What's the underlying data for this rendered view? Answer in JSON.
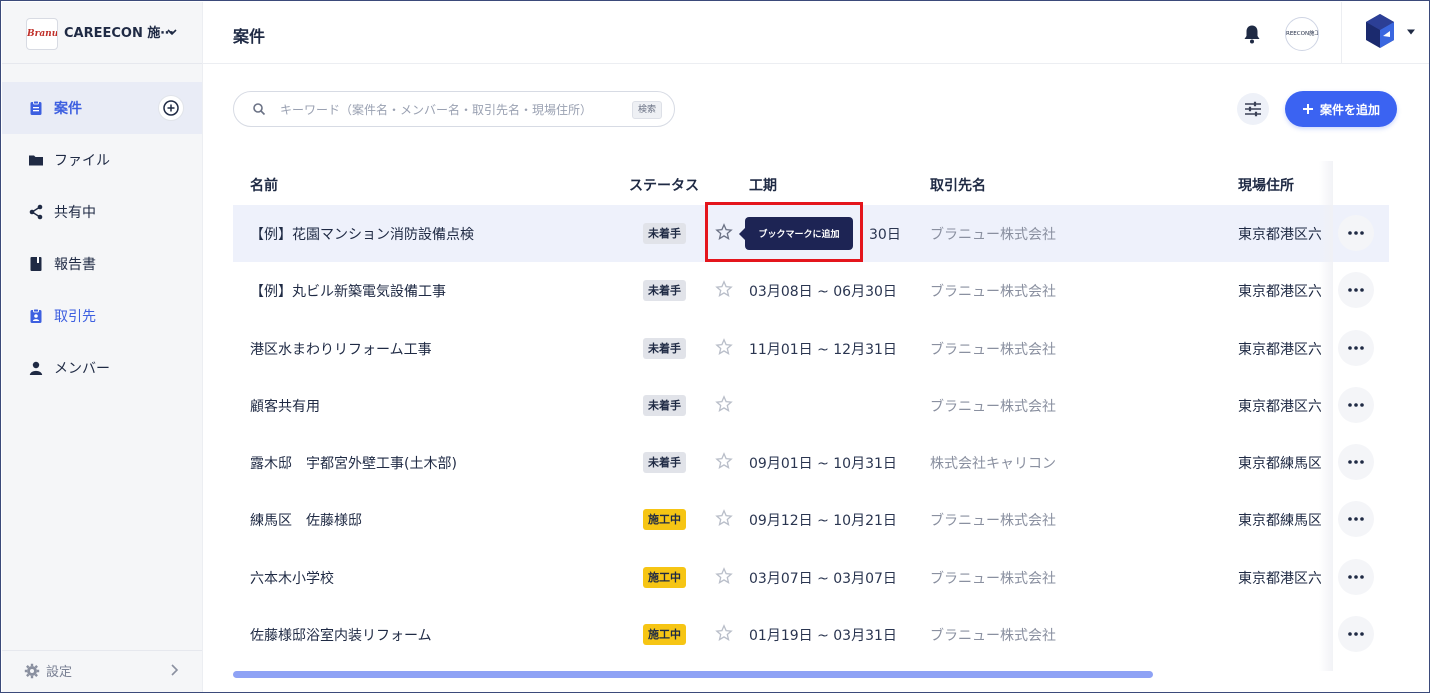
{
  "org": {
    "logo_text": "Branu",
    "name": "CAREECON 施⋯"
  },
  "sidebar": {
    "items": [
      {
        "label": "案件"
      },
      {
        "label": "ファイル"
      },
      {
        "label": "共有中"
      },
      {
        "label": "報告書"
      },
      {
        "label": "取引先"
      },
      {
        "label": "メンバー"
      }
    ],
    "settings_label": "設定"
  },
  "header": {
    "title": "案件",
    "avatar_text": "REECON施工"
  },
  "search": {
    "placeholder": "キーワード（案件名・メンバー名・取引先名・現場住所）",
    "kbd": "検索"
  },
  "toolbar": {
    "add_label": "案件を追加"
  },
  "table": {
    "columns": [
      "名前",
      "ステータス",
      "工期",
      "取引先名",
      "現場住所"
    ],
    "rows": [
      {
        "name": "【例】花園マンション消防設備点検",
        "status": "未着手",
        "status_color": "gray",
        "period": "30日",
        "client": "ブラニュー株式会社",
        "address": "東京都港区六"
      },
      {
        "name": "【例】丸ビル新築電気設備工事",
        "status": "未着手",
        "status_color": "gray",
        "period": "03月08日 ~ 06月30日",
        "client": "ブラニュー株式会社",
        "address": "東京都港区六"
      },
      {
        "name": "港区水まわりリフォーム工事",
        "status": "未着手",
        "status_color": "gray",
        "period": "11月01日 ~ 12月31日",
        "client": "ブラニュー株式会社",
        "address": "東京都港区六"
      },
      {
        "name": "顧客共有用",
        "status": "未着手",
        "status_color": "gray",
        "period": "",
        "client": "ブラニュー株式会社",
        "address": "東京都港区六"
      },
      {
        "name": "露木邸　宇都宮外壁工事(土木部)",
        "status": "未着手",
        "status_color": "gray",
        "period": "09月01日 ~ 10月31日",
        "client": "株式会社キャリコン",
        "address": "東京都練馬区"
      },
      {
        "name": "練馬区　佐藤様邸",
        "status": "施工中",
        "status_color": "yellow",
        "period": "09月12日 ~ 10月21日",
        "client": "ブラニュー株式会社",
        "address": "東京都練馬区"
      },
      {
        "name": "六本木小学校",
        "status": "施工中",
        "status_color": "yellow",
        "period": "03月07日 ~ 03月07日",
        "client": "ブラニュー株式会社",
        "address": "東京都港区六"
      },
      {
        "name": "佐藤様邸浴室内装リフォーム",
        "status": "施工中",
        "status_color": "yellow",
        "period": "01月19日 ~ 03月31日",
        "client": "ブラニュー株式会社",
        "address": ""
      }
    ]
  },
  "tooltip": {
    "text": "ブックマークに追加"
  },
  "colors": {
    "accent": "#3b63f2",
    "active_nav_bg": "#e9ecf6",
    "status_gray": "#e1e3e9",
    "status_yellow": "#f6c514",
    "tooltip_bg": "#1d2454",
    "highlight": "#e4151c"
  },
  "icons": {
    "sidebar": [
      "clipboard-icon",
      "folder-icon",
      "share-icon",
      "book-icon",
      "contact-badge-icon",
      "person-icon"
    ],
    "header": [
      "bell-icon",
      "app-cube-logo",
      "caret-down-icon"
    ]
  }
}
